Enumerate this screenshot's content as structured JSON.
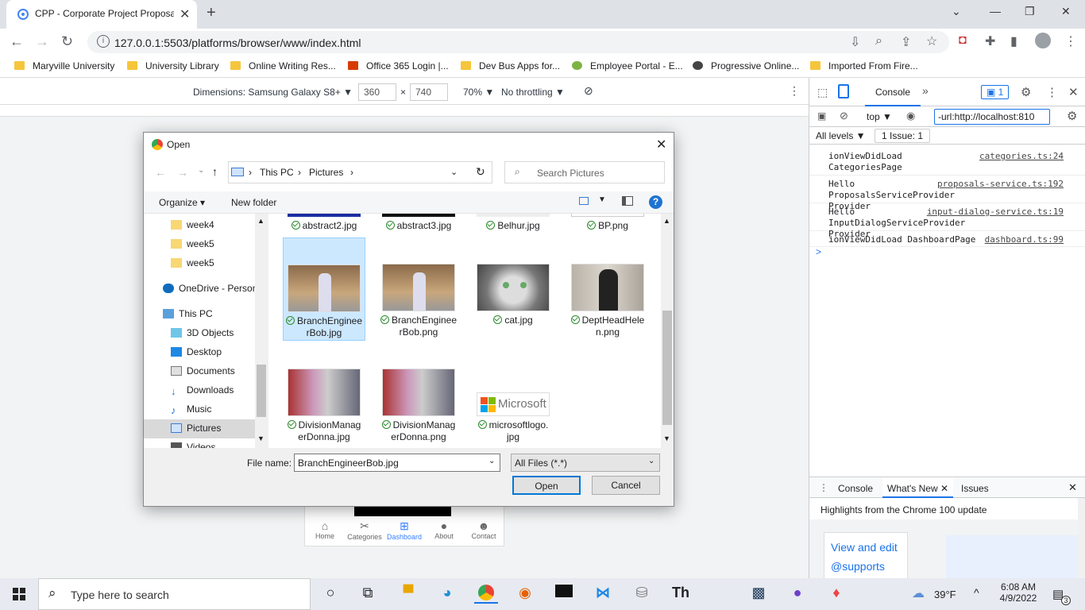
{
  "browser": {
    "tab_title": "CPP - Corporate Project Proposal",
    "url": "127.0.0.1:5503/platforms/browser/www/index.html",
    "bookmarks": [
      "Maryville University",
      "University Library",
      "Online Writing Res...",
      "Office 365 Login |...",
      "Dev Bus Apps for...",
      "Employee Portal - E...",
      "Progressive Online...",
      "Imported From Fire..."
    ]
  },
  "device_toolbar": {
    "dimensions_label": "Dimensions: Samsung Galaxy S8+ ▼",
    "width": "360",
    "times": "×",
    "height": "740",
    "zoom": "70% ▼",
    "throttle": "No throttling ▼"
  },
  "phone_nav": [
    {
      "label": "Home",
      "icon": "home-icon"
    },
    {
      "label": "Categories",
      "icon": "tools-icon"
    },
    {
      "label": "Dashboard",
      "icon": "grid-icon"
    },
    {
      "label": "About",
      "icon": "info-icon"
    },
    {
      "label": "Contact",
      "icon": "people-icon"
    }
  ],
  "devtools": {
    "panel_tab": "Console",
    "issue_count": "1",
    "context": "top ▼",
    "filter_value": "-url:http://localhost:810",
    "levels": "All levels ▼",
    "issues": "1 Issue:  1",
    "logs": [
      {
        "msg": "ionViewDidLoad CategoriesPage",
        "src": "categories.ts:24"
      },
      {
        "msg": "Hello ProposalsServiceProvider Provider",
        "src": "proposals-service.ts:192"
      },
      {
        "msg": "Hello InputDialogServiceProvider Provider",
        "src": "input-dialog-service.ts:19"
      },
      {
        "msg": "ionViewDidLoad DashboardPage",
        "src": "dashboard.ts:99"
      }
    ],
    "prompt": ">",
    "drawer_tabs": [
      "Console",
      "What's New",
      "Issues"
    ],
    "drawer_heading": "Highlights from the Chrome 100 update",
    "drawer_card": "View and edit @supports at-"
  },
  "dialog": {
    "title": "Open",
    "crumbs": [
      "This PC",
      "Pictures"
    ],
    "search_placeholder": "Search Pictures",
    "organize": "Organize ▾",
    "new_folder": "New folder",
    "help": "?",
    "nav_items": [
      "week4",
      "week5",
      "week5",
      "OneDrive - Person",
      "This PC",
      "3D Objects",
      "Desktop",
      "Documents",
      "Downloads",
      "Music",
      "Pictures",
      "Videos"
    ],
    "top_files": [
      "abstract2.jpg",
      "abstract3.jpg",
      "Belhur.jpg",
      "BP.png"
    ],
    "files": [
      {
        "name": "BranchEngineerBob.jpg",
        "line1": "BranchEnginee",
        "line2": "rBob.jpg"
      },
      {
        "name": "BranchEngineerBob.png",
        "line1": "BranchEnginee",
        "line2": "rBob.png"
      },
      {
        "name": "cat.jpg",
        "line1": "cat.jpg",
        "line2": ""
      },
      {
        "name": "DeptHeadHelen.png",
        "line1": "DeptHeadHele",
        "line2": "n.png"
      },
      {
        "name": "DivisionManagerDonna.jpg",
        "line1": "DivisionManag",
        "line2": "erDonna.jpg"
      },
      {
        "name": "DivisionManagerDonna.png",
        "line1": "DivisionManag",
        "line2": "erDonna.png"
      },
      {
        "name": "microsoftlogo.jpg",
        "line1": "microsoftlogo.",
        "line2": "jpg"
      }
    ],
    "ms_logo_text": "Microsoft",
    "filename_label": "File name:",
    "filename_value": "BranchEngineerBob.jpg",
    "filetype": "All Files (*.*)",
    "open_label": "Open",
    "cancel_label": "Cancel"
  },
  "taskbar": {
    "search_placeholder": "Type here to search",
    "weather": "39°F",
    "time": "6:08 AM",
    "date": "4/9/2022",
    "notif_count": "3"
  }
}
